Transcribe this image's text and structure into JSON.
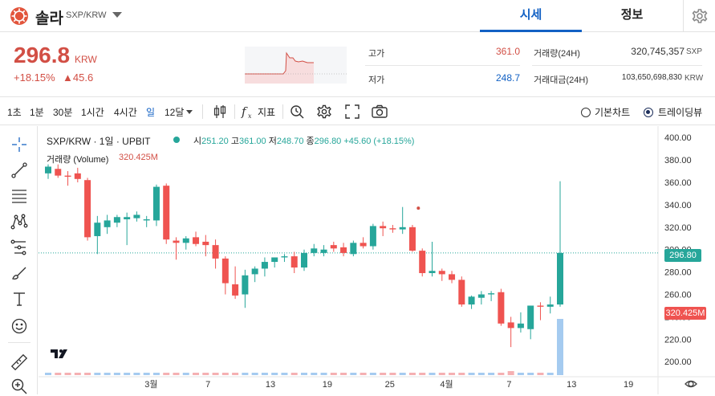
{
  "header": {
    "coin_name": "솔라",
    "pair": "SXP/KRW",
    "tabs": [
      {
        "label": "시세",
        "active": true
      },
      {
        "label": "정보",
        "active": false
      }
    ]
  },
  "price": {
    "current": "296.8",
    "unit": "KRW",
    "change_pct": "+18.15%",
    "change_amt": "▲45.6"
  },
  "stats": {
    "high_label": "고가",
    "high_value": "361.0",
    "low_label": "저가",
    "low_value": "248.7",
    "volume_label": "거래량(24H)",
    "volume_value": "320,745,357",
    "volume_unit": "SXP",
    "amount_label": "거래대금(24H)",
    "amount_value": "103,650,698,830",
    "amount_unit": "KRW"
  },
  "toolbar": {
    "intervals": [
      "1초",
      "1분",
      "30분",
      "1시간",
      "4시간",
      "일",
      "12달"
    ],
    "active_interval": "일",
    "indicator_label": "지표",
    "basic_chart_label": "기본차트",
    "tradingview_label": "트레이딩뷰",
    "selected_chart": "트레이딩뷰"
  },
  "legend": {
    "title": "SXP/KRW · 1일 · UPBIT",
    "open_label": "시",
    "open": "251.20",
    "high_label": "고",
    "high": "361.00",
    "low_label": "저",
    "low": "248.70",
    "close_label": "종",
    "close": "296.80",
    "change": "+45.60 (+18.15%)",
    "volume_label": "거래량 (Volume)",
    "volume_value": "320.425M"
  },
  "colors": {
    "up": "#26a69a",
    "down": "#ef5350",
    "accent": "#1261c4",
    "price_red": "#d24f45",
    "volume_up": "#9bc5ee",
    "volume_down": "#f4a7aa"
  },
  "chart_data": {
    "type": "candlestick",
    "ylim": [
      193,
      403
    ],
    "y_ticks": [
      "400.00",
      "380.00",
      "360.00",
      "340.00",
      "320.00",
      "300.00",
      "280.00",
      "260.00",
      "240.00",
      "220.00",
      "200.00"
    ],
    "x_ticks": [
      "3월",
      "7",
      "13",
      "19",
      "25",
      "4월",
      "7",
      "13",
      "19"
    ],
    "last_price_label": "296.80",
    "last_volume_label": "320.425M",
    "candles": [
      {
        "o": 368,
        "h": 376,
        "l": 363,
        "c": 374
      },
      {
        "o": 372,
        "h": 376,
        "l": 364,
        "c": 366
      },
      {
        "o": 366,
        "h": 370,
        "l": 357,
        "c": 365
      },
      {
        "o": 368,
        "h": 373,
        "l": 360,
        "c": 363
      },
      {
        "o": 362,
        "h": 364,
        "l": 308,
        "c": 311
      },
      {
        "o": 312,
        "h": 330,
        "l": 296,
        "c": 324
      },
      {
        "o": 320,
        "h": 331,
        "l": 314,
        "c": 326
      },
      {
        "o": 324,
        "h": 331,
        "l": 320,
        "c": 329
      },
      {
        "o": 327,
        "h": 333,
        "l": 304,
        "c": 329
      },
      {
        "o": 328,
        "h": 334,
        "l": 325,
        "c": 331
      },
      {
        "o": 326,
        "h": 330,
        "l": 320,
        "c": 327
      },
      {
        "o": 326,
        "h": 358,
        "l": 321,
        "c": 356
      },
      {
        "o": 357,
        "h": 359,
        "l": 305,
        "c": 309
      },
      {
        "o": 308,
        "h": 311,
        "l": 291,
        "c": 306
      },
      {
        "o": 306,
        "h": 312,
        "l": 300,
        "c": 310
      },
      {
        "o": 311,
        "h": 316,
        "l": 303,
        "c": 305
      },
      {
        "o": 307,
        "h": 313,
        "l": 294,
        "c": 304
      },
      {
        "o": 304,
        "h": 309,
        "l": 283,
        "c": 292
      },
      {
        "o": 292,
        "h": 294,
        "l": 260,
        "c": 270
      },
      {
        "o": 269,
        "h": 285,
        "l": 256,
        "c": 259
      },
      {
        "o": 260,
        "h": 282,
        "l": 248,
        "c": 277
      },
      {
        "o": 278,
        "h": 285,
        "l": 271,
        "c": 283
      },
      {
        "o": 283,
        "h": 293,
        "l": 276,
        "c": 289
      },
      {
        "o": 289,
        "h": 293,
        "l": 284,
        "c": 293
      },
      {
        "o": 293,
        "h": 296,
        "l": 289,
        "c": 294
      },
      {
        "o": 294,
        "h": 298,
        "l": 279,
        "c": 284
      },
      {
        "o": 284,
        "h": 300,
        "l": 281,
        "c": 297
      },
      {
        "o": 297,
        "h": 305,
        "l": 294,
        "c": 301
      },
      {
        "o": 297,
        "h": 304,
        "l": 294,
        "c": 300
      },
      {
        "o": 304,
        "h": 307,
        "l": 298,
        "c": 301
      },
      {
        "o": 302,
        "h": 306,
        "l": 294,
        "c": 297
      },
      {
        "o": 296,
        "h": 308,
        "l": 294,
        "c": 306
      },
      {
        "o": 306,
        "h": 311,
        "l": 301,
        "c": 303
      },
      {
        "o": 303,
        "h": 323,
        "l": 300,
        "c": 321
      },
      {
        "o": 321,
        "h": 325,
        "l": 312,
        "c": 319
      },
      {
        "o": 319,
        "h": 322,
        "l": 315,
        "c": 318
      },
      {
        "o": 318,
        "h": 338,
        "l": 314,
        "c": 320
      },
      {
        "o": 320,
        "h": 322,
        "l": 298,
        "c": 299
      },
      {
        "o": 299,
        "h": 301,
        "l": 276,
        "c": 279
      },
      {
        "o": 279,
        "h": 307,
        "l": 276,
        "c": 281
      },
      {
        "o": 281,
        "h": 283,
        "l": 272,
        "c": 278
      },
      {
        "o": 278,
        "h": 281,
        "l": 270,
        "c": 273
      },
      {
        "o": 273,
        "h": 276,
        "l": 249,
        "c": 251
      },
      {
        "o": 251,
        "h": 259,
        "l": 247,
        "c": 258
      },
      {
        "o": 257,
        "h": 263,
        "l": 251,
        "c": 260
      },
      {
        "o": 260,
        "h": 263,
        "l": 254,
        "c": 261
      },
      {
        "o": 262,
        "h": 265,
        "l": 232,
        "c": 234
      },
      {
        "o": 235,
        "h": 240,
        "l": 213,
        "c": 230
      },
      {
        "o": 230,
        "h": 244,
        "l": 226,
        "c": 234
      },
      {
        "o": 229,
        "h": 250,
        "l": 220,
        "c": 250
      },
      {
        "o": 250,
        "h": 253,
        "l": 237,
        "c": 249
      },
      {
        "o": 249,
        "h": 258,
        "l": 243,
        "c": 251
      },
      {
        "o": 251,
        "h": 361,
        "l": 249,
        "c": 297
      }
    ]
  }
}
